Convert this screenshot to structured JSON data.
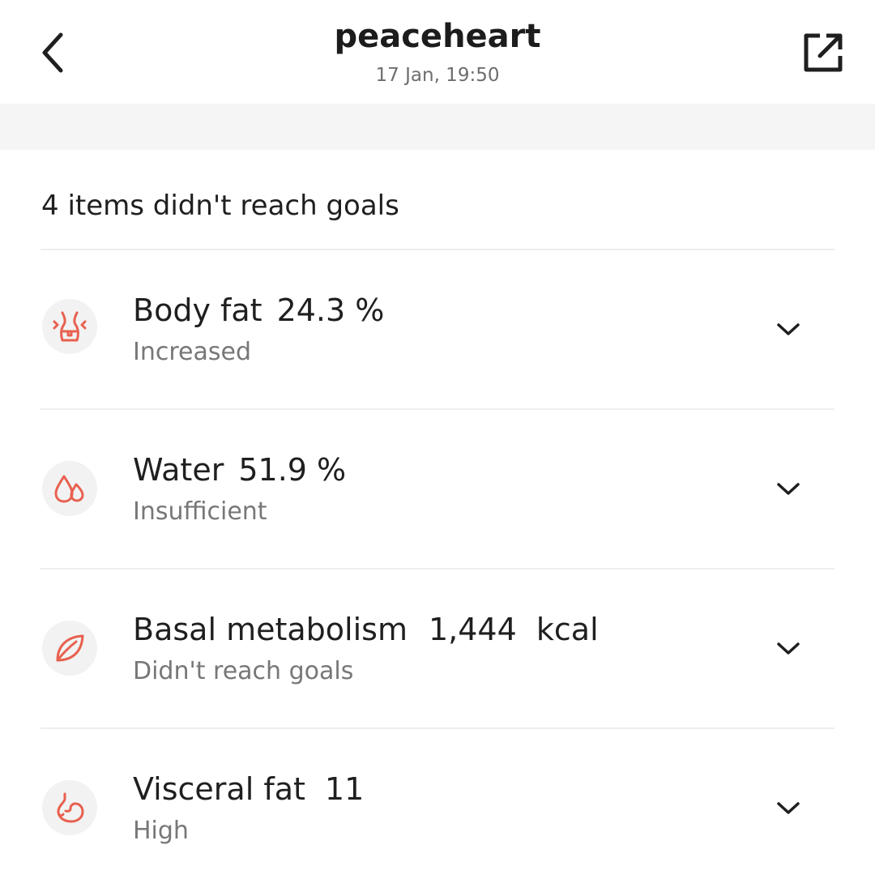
{
  "header": {
    "title": "peaceheart",
    "timestamp": "17 Jan, 19:50",
    "back_icon": "chevron-left-icon",
    "share_icon": "share-external-icon"
  },
  "summary": "4 items didn't reach goals",
  "accent_color": "#e8604f",
  "items": [
    {
      "label": "Body fat",
      "value": "24.3 %",
      "status": "Increased",
      "icon": "body-waist-icon"
    },
    {
      "label": "Water",
      "value": "51.9 %",
      "status": "Insufficient",
      "icon": "water-drops-icon"
    },
    {
      "label": "Basal metabolism",
      "value": "1,444  kcal",
      "status": "Didn't reach goals",
      "icon": "leaf-icon"
    },
    {
      "label": "Visceral fat",
      "value": "11",
      "status": "High",
      "icon": "stomach-icon"
    }
  ]
}
